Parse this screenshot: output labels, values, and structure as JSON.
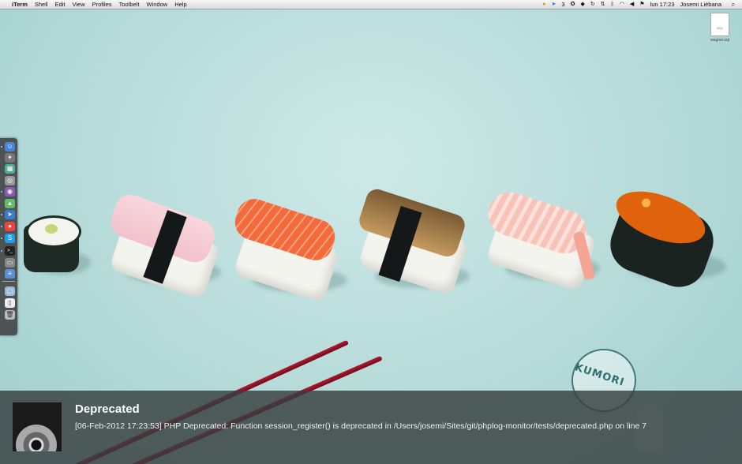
{
  "menubar": {
    "apple": "",
    "app_name": "iTerm",
    "menus": [
      "Shell",
      "Edit",
      "View",
      "Profiles",
      "Toolbelt",
      "Window",
      "Help"
    ],
    "status": {
      "badge_count": "3",
      "clock": "lun 17:23",
      "user": "Josemi Liébana"
    }
  },
  "desktop": {
    "file": {
      "type_label": "SQL",
      "name": "wagner.sql"
    }
  },
  "dock": {
    "apps": [
      "finder-icon",
      "safari-icon",
      "photos-icon",
      "screenshot-icon",
      "tor-icon",
      "android-icon",
      "cursor-icon",
      "chrome-icon",
      "skype-icon",
      "terminal-icon",
      "window-icon",
      "stack-icon",
      "folder-icon",
      "document-icon",
      "trash-icon"
    ]
  },
  "notification": {
    "title": "Deprecated",
    "message": "[06-Feb-2012 17:23:53] PHP Deprecated:  Function session_register() is deprecated in /Users/josemi/Sites/git/phplog-monitor/tests/deprecated.php on line 7"
  },
  "wallpaper": {
    "logo_text": "KUMORI"
  },
  "colors": {
    "background": "#bfe0df",
    "chopsticks": "#b21a33",
    "notification_bg": "#373e3e"
  }
}
